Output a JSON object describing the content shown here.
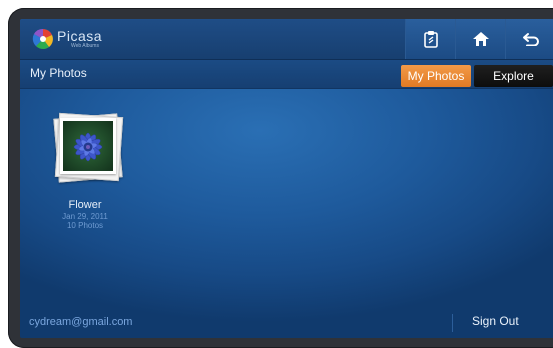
{
  "app": {
    "logo_name": "Picasa",
    "logo_sub": "Web Albums"
  },
  "toolbar": {
    "buttons": [
      {
        "icon": "clipboard-icon"
      },
      {
        "icon": "home-icon"
      },
      {
        "icon": "back-icon"
      }
    ]
  },
  "header": {
    "title": "My Photos"
  },
  "tabs": [
    {
      "label": "My Photos",
      "active": true,
      "color": "#e98a33"
    },
    {
      "label": "Explore",
      "active": false,
      "color": "#111111"
    }
  ],
  "albums": [
    {
      "title": "Flower",
      "date": "Jan 29, 2011",
      "count": "10 Photos"
    }
  ],
  "footer": {
    "email": "cydream@gmail.com",
    "sign_out": "Sign Out"
  }
}
